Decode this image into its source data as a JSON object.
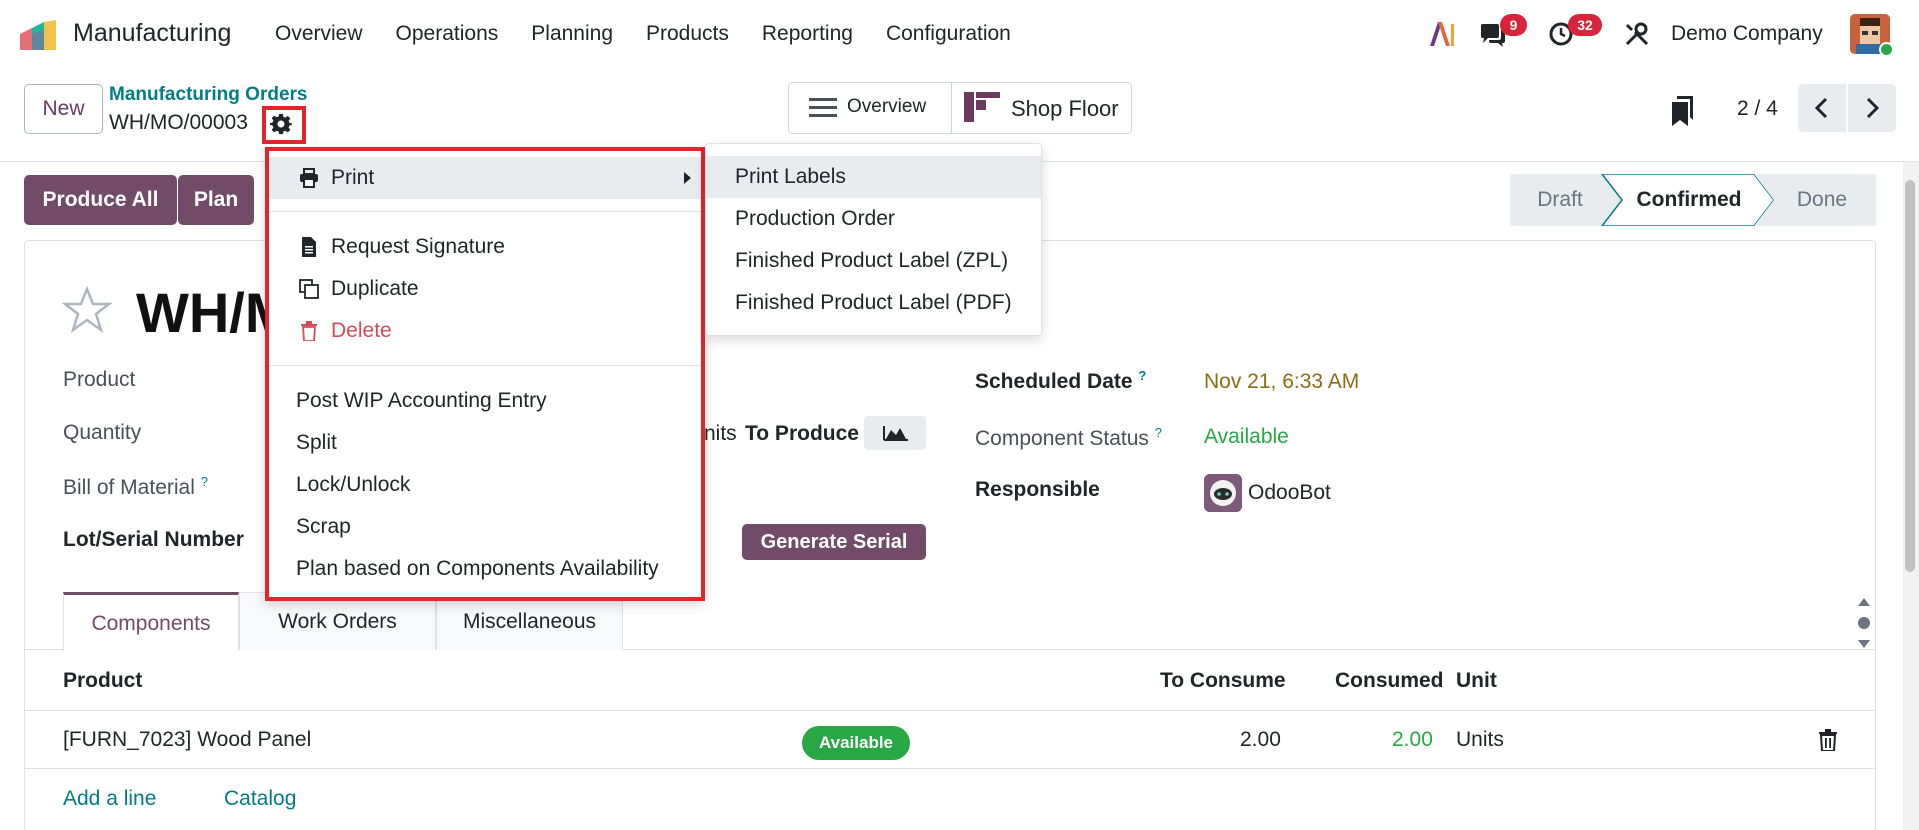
{
  "navbar": {
    "app_name": "Manufacturing",
    "menu": [
      "Overview",
      "Operations",
      "Planning",
      "Products",
      "Reporting",
      "Configuration"
    ],
    "messages_count": "9",
    "activities_count": "32",
    "company": "Demo Company"
  },
  "control_panel": {
    "new_label": "New",
    "breadcrumb": "Manufacturing Orders",
    "record_name": "WH/MO/00003",
    "view_overview": "Overview",
    "view_shop_floor": "Shop Floor",
    "pager": "2 / 4"
  },
  "actions": {
    "produce_all": "Produce All",
    "plan": "Plan"
  },
  "statusbar": {
    "stages": [
      "Draft",
      "Confirmed",
      "Done"
    ],
    "current": "Confirmed"
  },
  "form": {
    "title": "WH/M",
    "labels": {
      "product": "Product",
      "quantity": "Quantity",
      "bom": "Bill of Material",
      "lot": "Lot/Serial Number",
      "units_to_produce_prefix": "nits",
      "to_produce": "To Produce",
      "scheduled_date": "Scheduled Date",
      "component_status": "Component Status",
      "responsible": "Responsible"
    },
    "values": {
      "scheduled_date": "Nov 21, 6:33 AM",
      "component_status": "Available",
      "responsible": "OdooBot"
    },
    "generate_serial": "Generate Serial",
    "help_mark": "?"
  },
  "tabs": [
    "Components",
    "Work Orders",
    "Miscellaneous"
  ],
  "components_table": {
    "headers": [
      "Product",
      "To Consume",
      "Consumed",
      "Unit"
    ],
    "rows": [
      {
        "product": "[FURN_7023] Wood Panel",
        "status": "Available",
        "to_consume": "2.00",
        "consumed": "2.00",
        "unit": "Units"
      }
    ],
    "add_line": "Add a line",
    "catalog": "Catalog"
  },
  "gear_menu": {
    "print": "Print",
    "request_signature": "Request Signature",
    "duplicate": "Duplicate",
    "delete": "Delete",
    "post_wip": "Post WIP Accounting Entry",
    "split": "Split",
    "lock_unlock": "Lock/Unlock",
    "scrap": "Scrap",
    "plan_availability": "Plan based on Components Availability"
  },
  "print_submenu": [
    "Print Labels",
    "Production Order",
    "Finished Product Label (ZPL)",
    "Finished Product Label (PDF)"
  ],
  "colors": {
    "brand": "#714b67",
    "link": "#017e84",
    "danger": "#d44c59",
    "success": "#28a745",
    "highlight_box": "#e2242b",
    "date_warning": "#8a6d12"
  }
}
